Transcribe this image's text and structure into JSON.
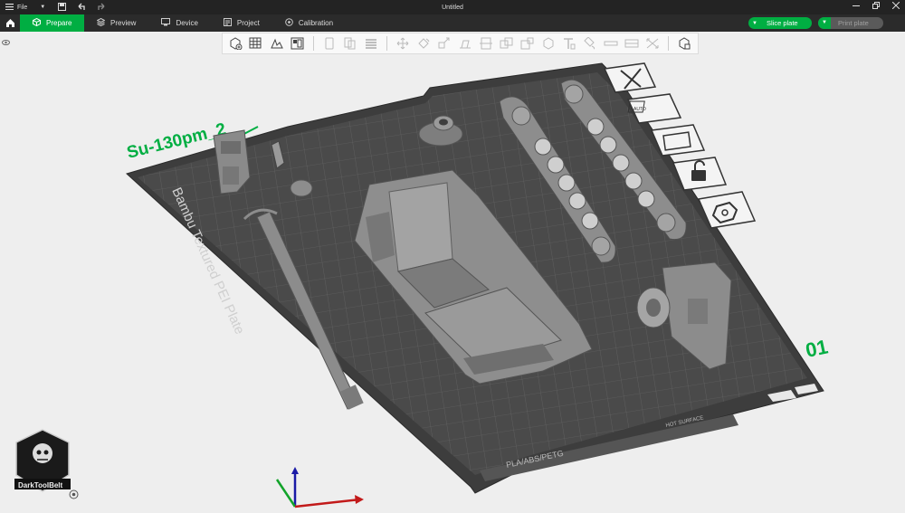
{
  "window": {
    "file_menu": "File",
    "title": "Untitled"
  },
  "tabs": [
    {
      "label": "Prepare",
      "icon": "cube-icon"
    },
    {
      "label": "Preview",
      "icon": "layers-icon"
    },
    {
      "label": "Device",
      "icon": "device-icon"
    },
    {
      "label": "Project",
      "icon": "project-icon"
    },
    {
      "label": "Calibration",
      "icon": "calibration-icon"
    }
  ],
  "actions": {
    "slice_label": "Slice plate",
    "print_label": "Print plate"
  },
  "plate": {
    "name": "Bambu Textured PEI Plate",
    "number": "01",
    "model_label": "Su-130pm_2",
    "filament_label": "PLA/ABS/PETG",
    "surface_label": "HOT SURFACE",
    "auto_label": "AUTO"
  },
  "logo": {
    "text": "DarkToolBelt"
  },
  "colors": {
    "accent": "#00ae42",
    "plate": "#474747",
    "model": "#8a8a8a"
  }
}
